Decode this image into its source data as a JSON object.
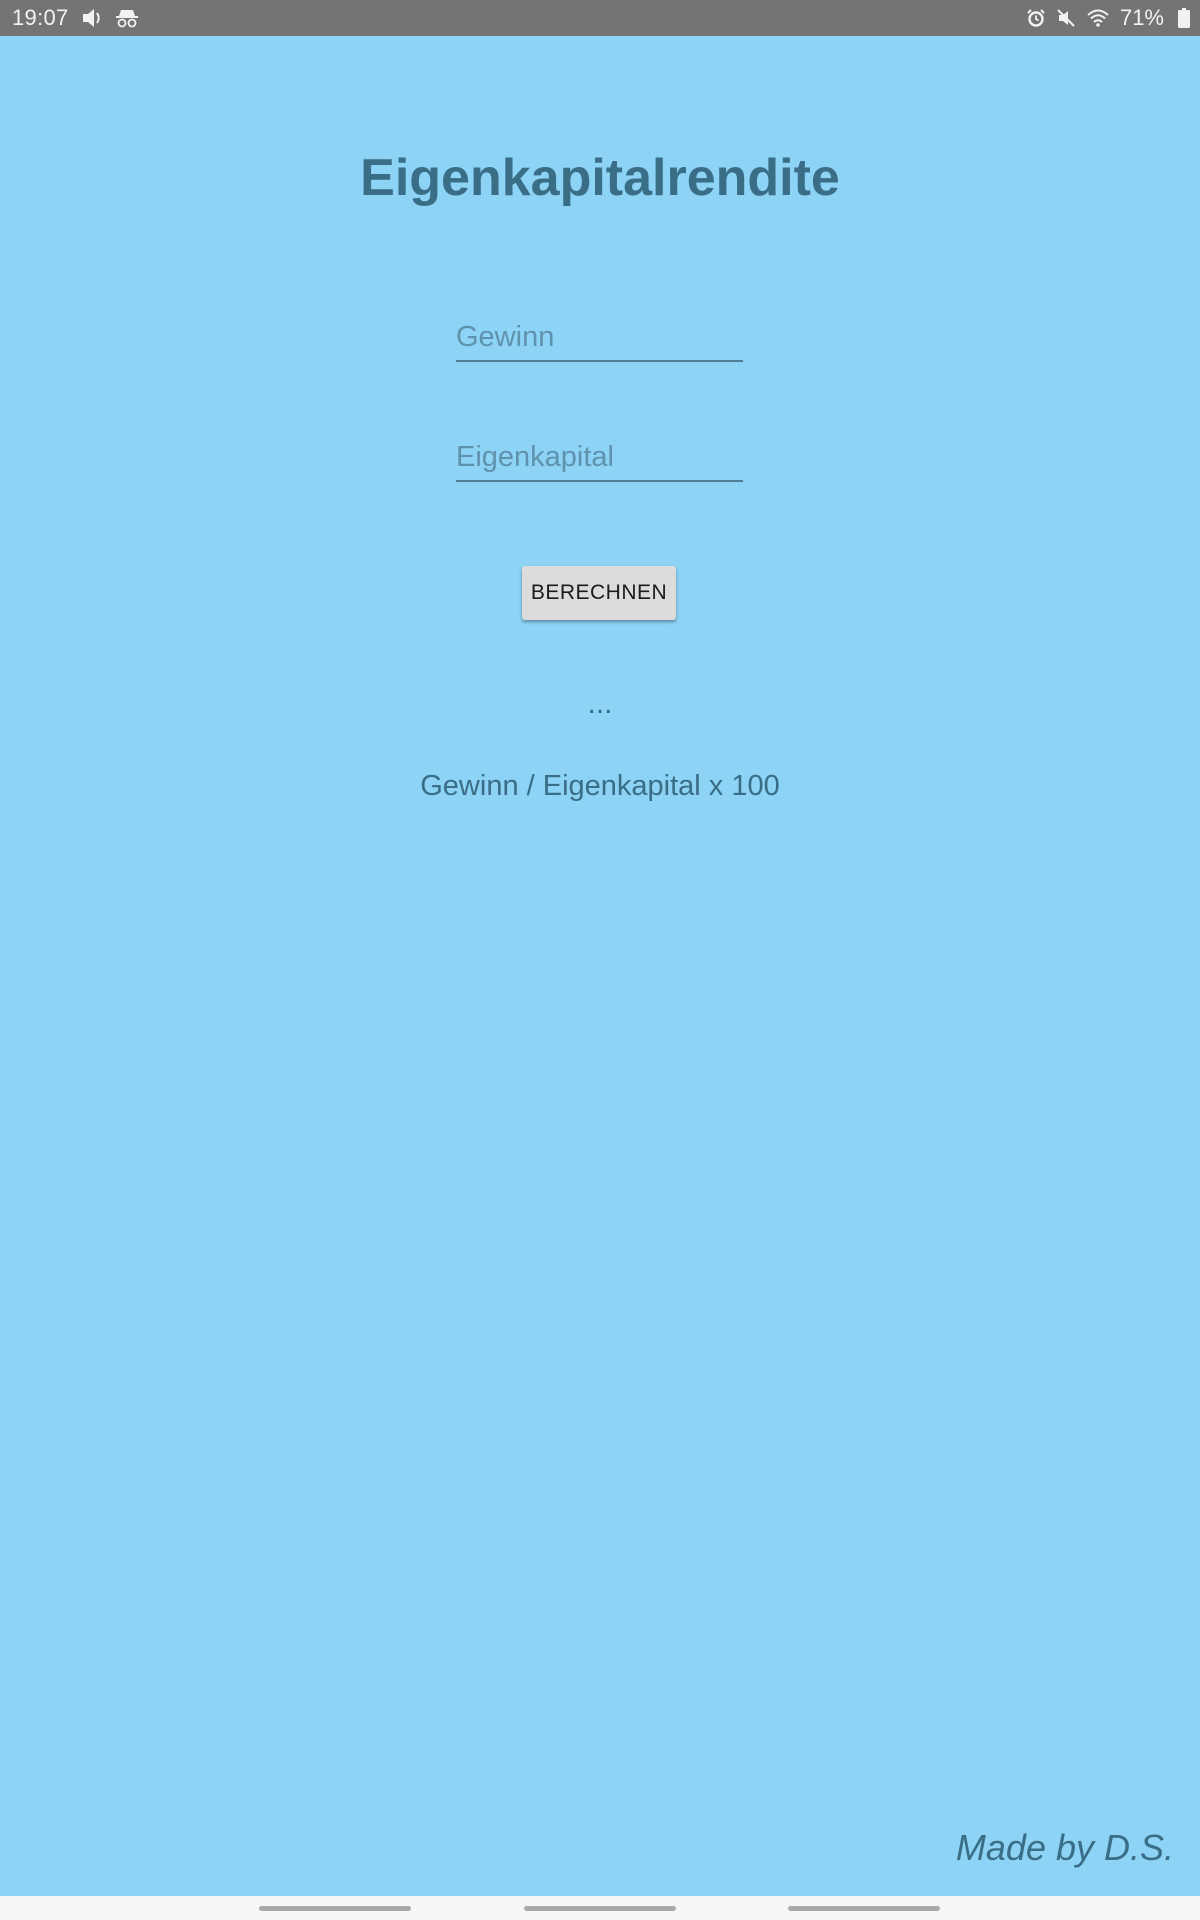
{
  "status_bar": {
    "time": "19:07",
    "battery_percent": "71%",
    "icons_left": [
      "volume-icon",
      "incognito-icon"
    ],
    "icons_right": [
      "alarm-icon",
      "mute-icon",
      "wifi-icon",
      "battery-icon"
    ]
  },
  "app": {
    "title": "Eigenkapitalrendite",
    "inputs": {
      "gewinn_placeholder": "Gewinn",
      "gewinn_value": "",
      "eigenkapital_placeholder": "Eigenkapital",
      "eigenkapital_value": ""
    },
    "button_label": "BERECHNEN",
    "result": "...",
    "formula": "Gewinn / Eigenkapital x 100",
    "credit": "Made by D.S."
  },
  "nav_bar": {
    "items": [
      "recents-pill",
      "home-pill",
      "back-pill"
    ]
  },
  "colors": {
    "background": "#8cd3f5",
    "text_primary": "#3a6d86",
    "status_bar": "#747474",
    "button": "#dcdcdc"
  }
}
